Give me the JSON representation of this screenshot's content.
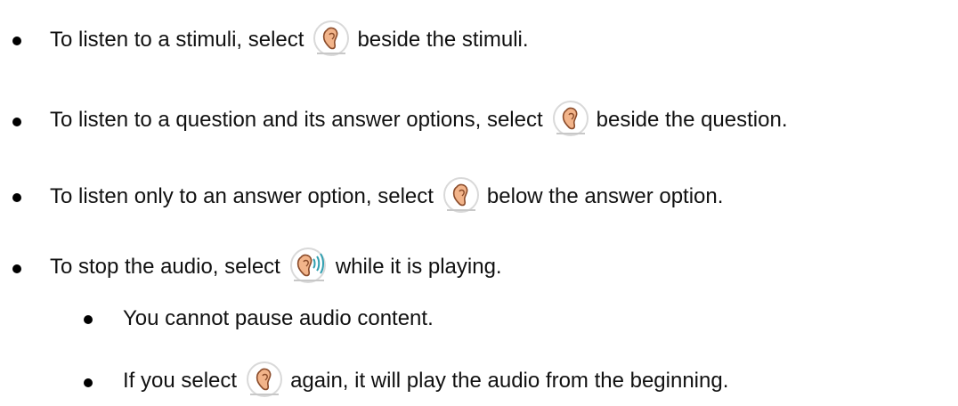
{
  "instructions": {
    "items": [
      {
        "before": "To listen to a stimuli, select",
        "icon": "ear-icon",
        "after": "beside the stimuli."
      },
      {
        "before": "To listen to a question and its answer options, select",
        "icon": "ear-icon",
        "after": "beside the question."
      },
      {
        "before": "To listen only to an answer option, select",
        "icon": "ear-icon",
        "after": "below the answer option."
      },
      {
        "before": "To stop the audio, select",
        "icon": "ear-playing-icon",
        "after": "while it is playing."
      }
    ],
    "subitems": [
      {
        "text": "You cannot pause audio content."
      },
      {
        "before": "If you select",
        "icon": "ear-icon",
        "after": "again, it will play the audio from the beginning."
      }
    ]
  },
  "colors": {
    "ear_skin": "#f2b48a",
    "ear_outline": "#8a4b2a",
    "button_ring": "#d9d9d9",
    "sound_wave": "#2f9fb0",
    "underline": "#c8c8c8"
  }
}
